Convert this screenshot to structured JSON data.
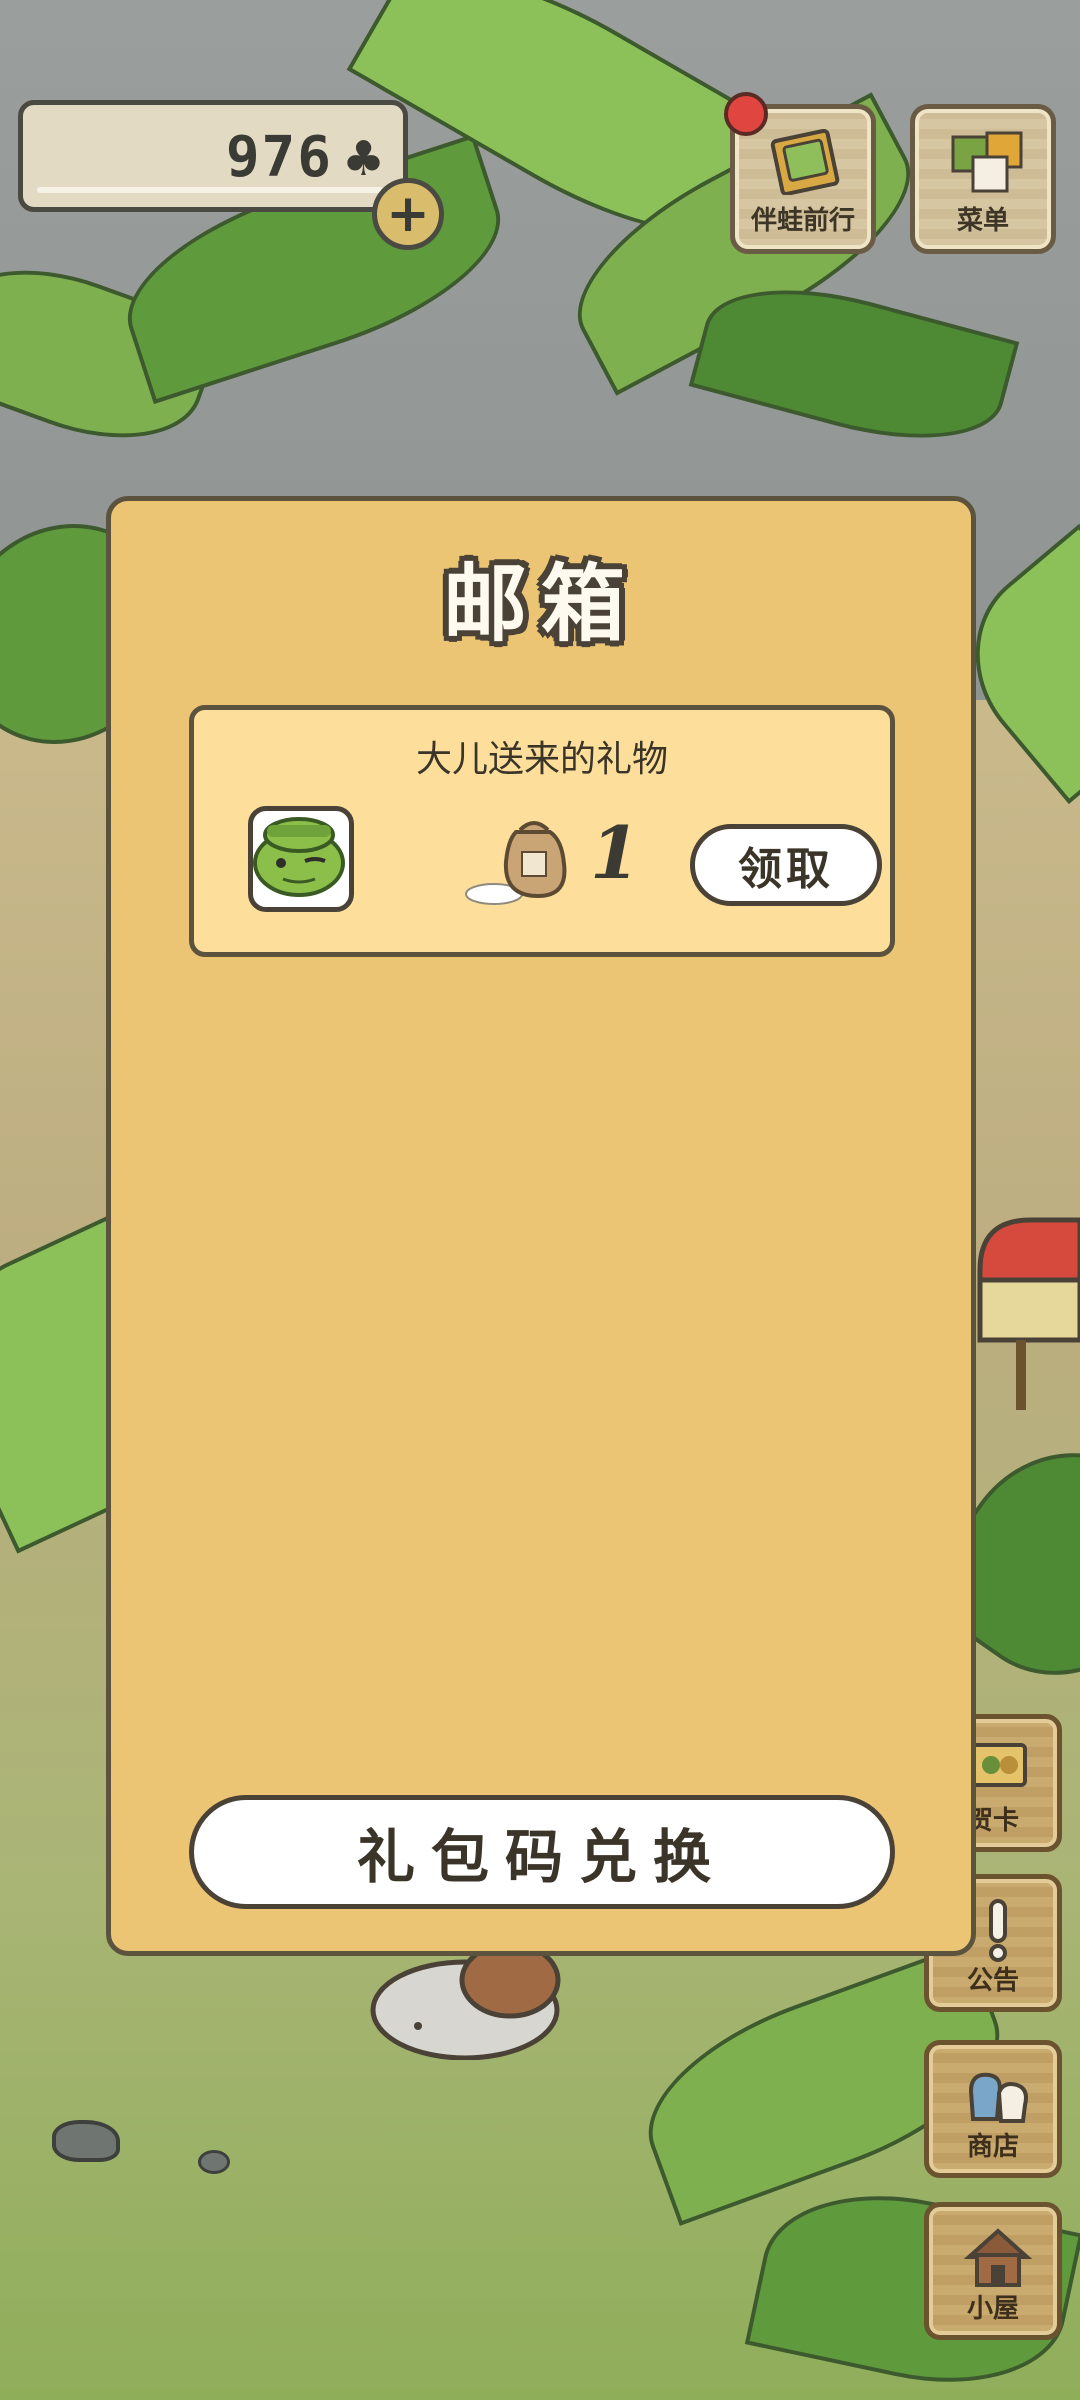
{
  "hud": {
    "clover_count": "976",
    "clover_icon": "clover-icon",
    "plus_icon": "plus-icon",
    "plus_symbol": "+"
  },
  "top_buttons": [
    {
      "label": "伴蛙前行",
      "icon": "album-icon",
      "has_notification": true
    },
    {
      "label": "菜单",
      "icon": "menu-cards-icon"
    }
  ],
  "mailbox": {
    "title": "邮箱",
    "items": [
      {
        "title": "大儿送来的礼物",
        "sender_icon": "frog-avatar-icon",
        "gift_icon": "rice-bag-icon",
        "gift_count": "1",
        "claim_label": "领取"
      }
    ],
    "redeem_label": "礼包码兑换"
  },
  "side_buttons": [
    {
      "label": "贺卡",
      "icon": "card-icon"
    },
    {
      "label": "公告",
      "icon": "exclamation-icon"
    },
    {
      "label": "商店",
      "icon": "shop-bags-icon"
    },
    {
      "label": "小屋",
      "icon": "house-icon"
    }
  ],
  "colors": {
    "panel_bg": "#ecc574",
    "item_bg": "#fddf9b",
    "outline": "#4a4236",
    "notification": "#e0463f"
  }
}
